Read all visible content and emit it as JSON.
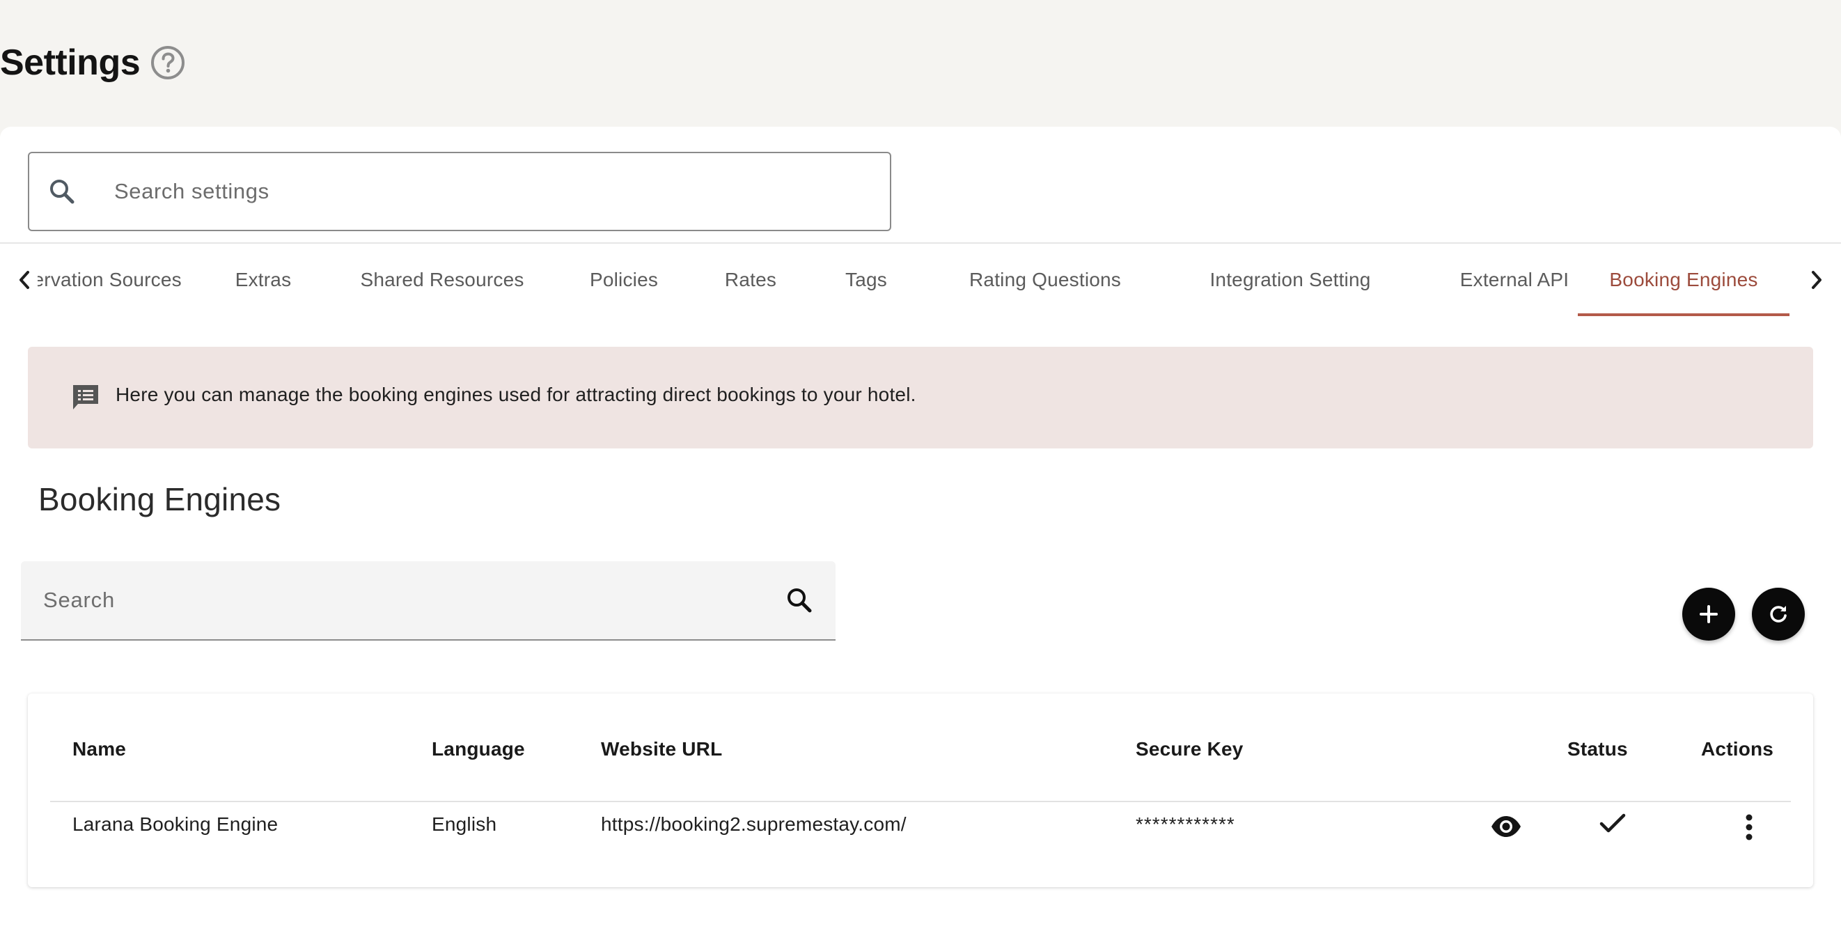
{
  "page": {
    "title": "Settings",
    "help_icon": "help-circle-icon"
  },
  "settings_search": {
    "placeholder": "Search settings",
    "icon": "search-icon"
  },
  "tabs": {
    "prev_icon": "chevron-left-icon",
    "next_icon": "chevron-right-icon",
    "items": [
      {
        "label": "Reservation Sources",
        "active": false
      },
      {
        "label": "Extras",
        "active": false
      },
      {
        "label": "Shared Resources",
        "active": false
      },
      {
        "label": "Policies",
        "active": false
      },
      {
        "label": "Rates",
        "active": false
      },
      {
        "label": "Tags",
        "active": false
      },
      {
        "label": "Rating Questions",
        "active": false
      },
      {
        "label": "Integration Setting",
        "active": false
      },
      {
        "label": "External API",
        "active": false
      },
      {
        "label": "Booking Engines",
        "active": true
      }
    ]
  },
  "info_banner": {
    "icon": "message-list-icon",
    "text": "Here you can manage the booking engines used for attracting direct bookings to your hotel."
  },
  "section": {
    "title": "Booking Engines"
  },
  "list_search": {
    "placeholder": "Search",
    "icon": "search-icon"
  },
  "actions": {
    "add_icon": "plus-icon",
    "refresh_icon": "refresh-icon"
  },
  "table": {
    "headers": {
      "name": "Name",
      "language": "Language",
      "website_url": "Website URL",
      "secure_key": "Secure Key",
      "status": "Status",
      "actions": "Actions"
    },
    "rows": [
      {
        "name": "Larana Booking Engine",
        "language": "English",
        "website_url": "https://booking2.supremestay.com/",
        "secure_key": "************",
        "reveal_icon": "eye-icon",
        "status_icon": "check-icon",
        "actions_icon": "more-vertical-icon"
      }
    ]
  },
  "colors": {
    "background": "#f5f4f1",
    "accent": "#9c4b3c",
    "banner_bg": "#efe4e2",
    "fab": "#0a0a0a"
  }
}
